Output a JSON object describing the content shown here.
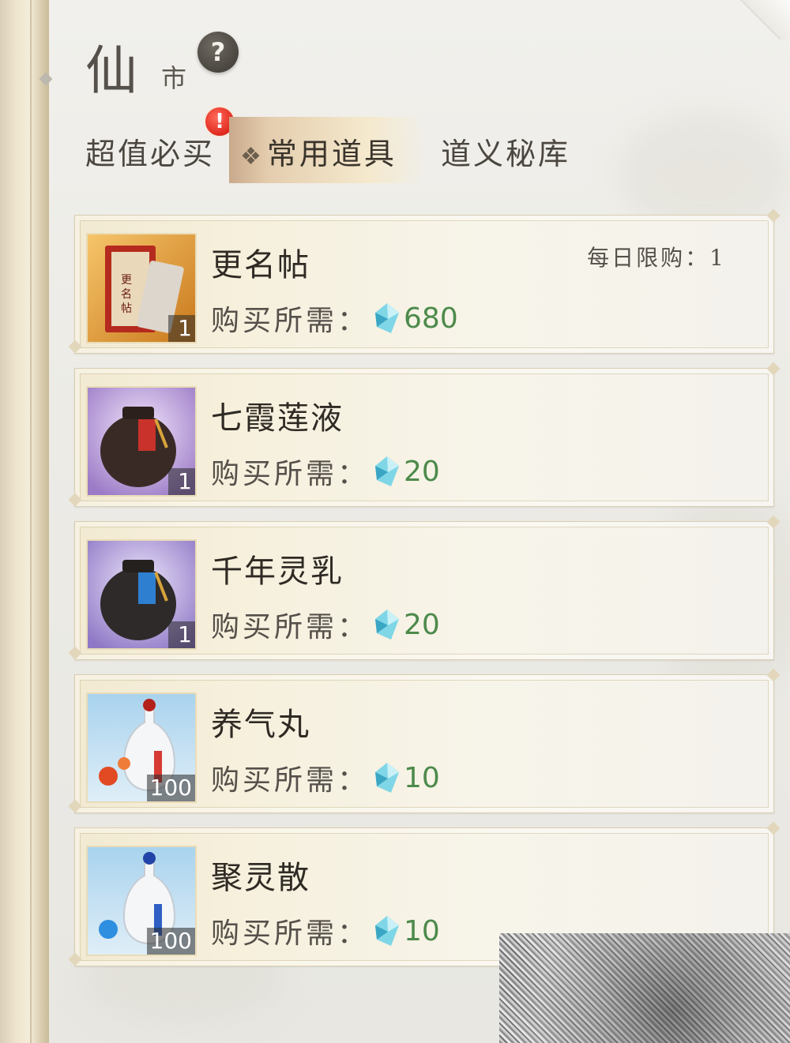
{
  "header": {
    "title_big": "仙",
    "title_small": "市",
    "help_label": "?"
  },
  "tabs": [
    {
      "label": "超值必买",
      "active": false,
      "alert": "!"
    },
    {
      "label": "常用道具",
      "active": true,
      "marker": "❖"
    },
    {
      "label": "道义秘库",
      "active": false
    }
  ],
  "price_label": "购买所需：",
  "currency_icon": "jade-gem-icon",
  "items": [
    {
      "name": "更名帖",
      "count": "1",
      "price": "680",
      "limit_label": "每日限购：",
      "limit_value": "1",
      "icon": "rename-card-icon"
    },
    {
      "name": "七霞莲液",
      "count": "1",
      "price": "20",
      "icon": "red-jar-icon"
    },
    {
      "name": "千年灵乳",
      "count": "1",
      "price": "20",
      "icon": "blue-jar-icon"
    },
    {
      "name": "养气丸",
      "count": "100",
      "price": "10",
      "icon": "red-vase-pill-icon"
    },
    {
      "name": "聚灵散",
      "count": "100",
      "price": "10",
      "icon": "blue-vase-pill-icon"
    }
  ],
  "colors": {
    "price_green": "#4d8a4b",
    "alert_red": "#e0281e",
    "active_tab": "#e4cdae"
  }
}
